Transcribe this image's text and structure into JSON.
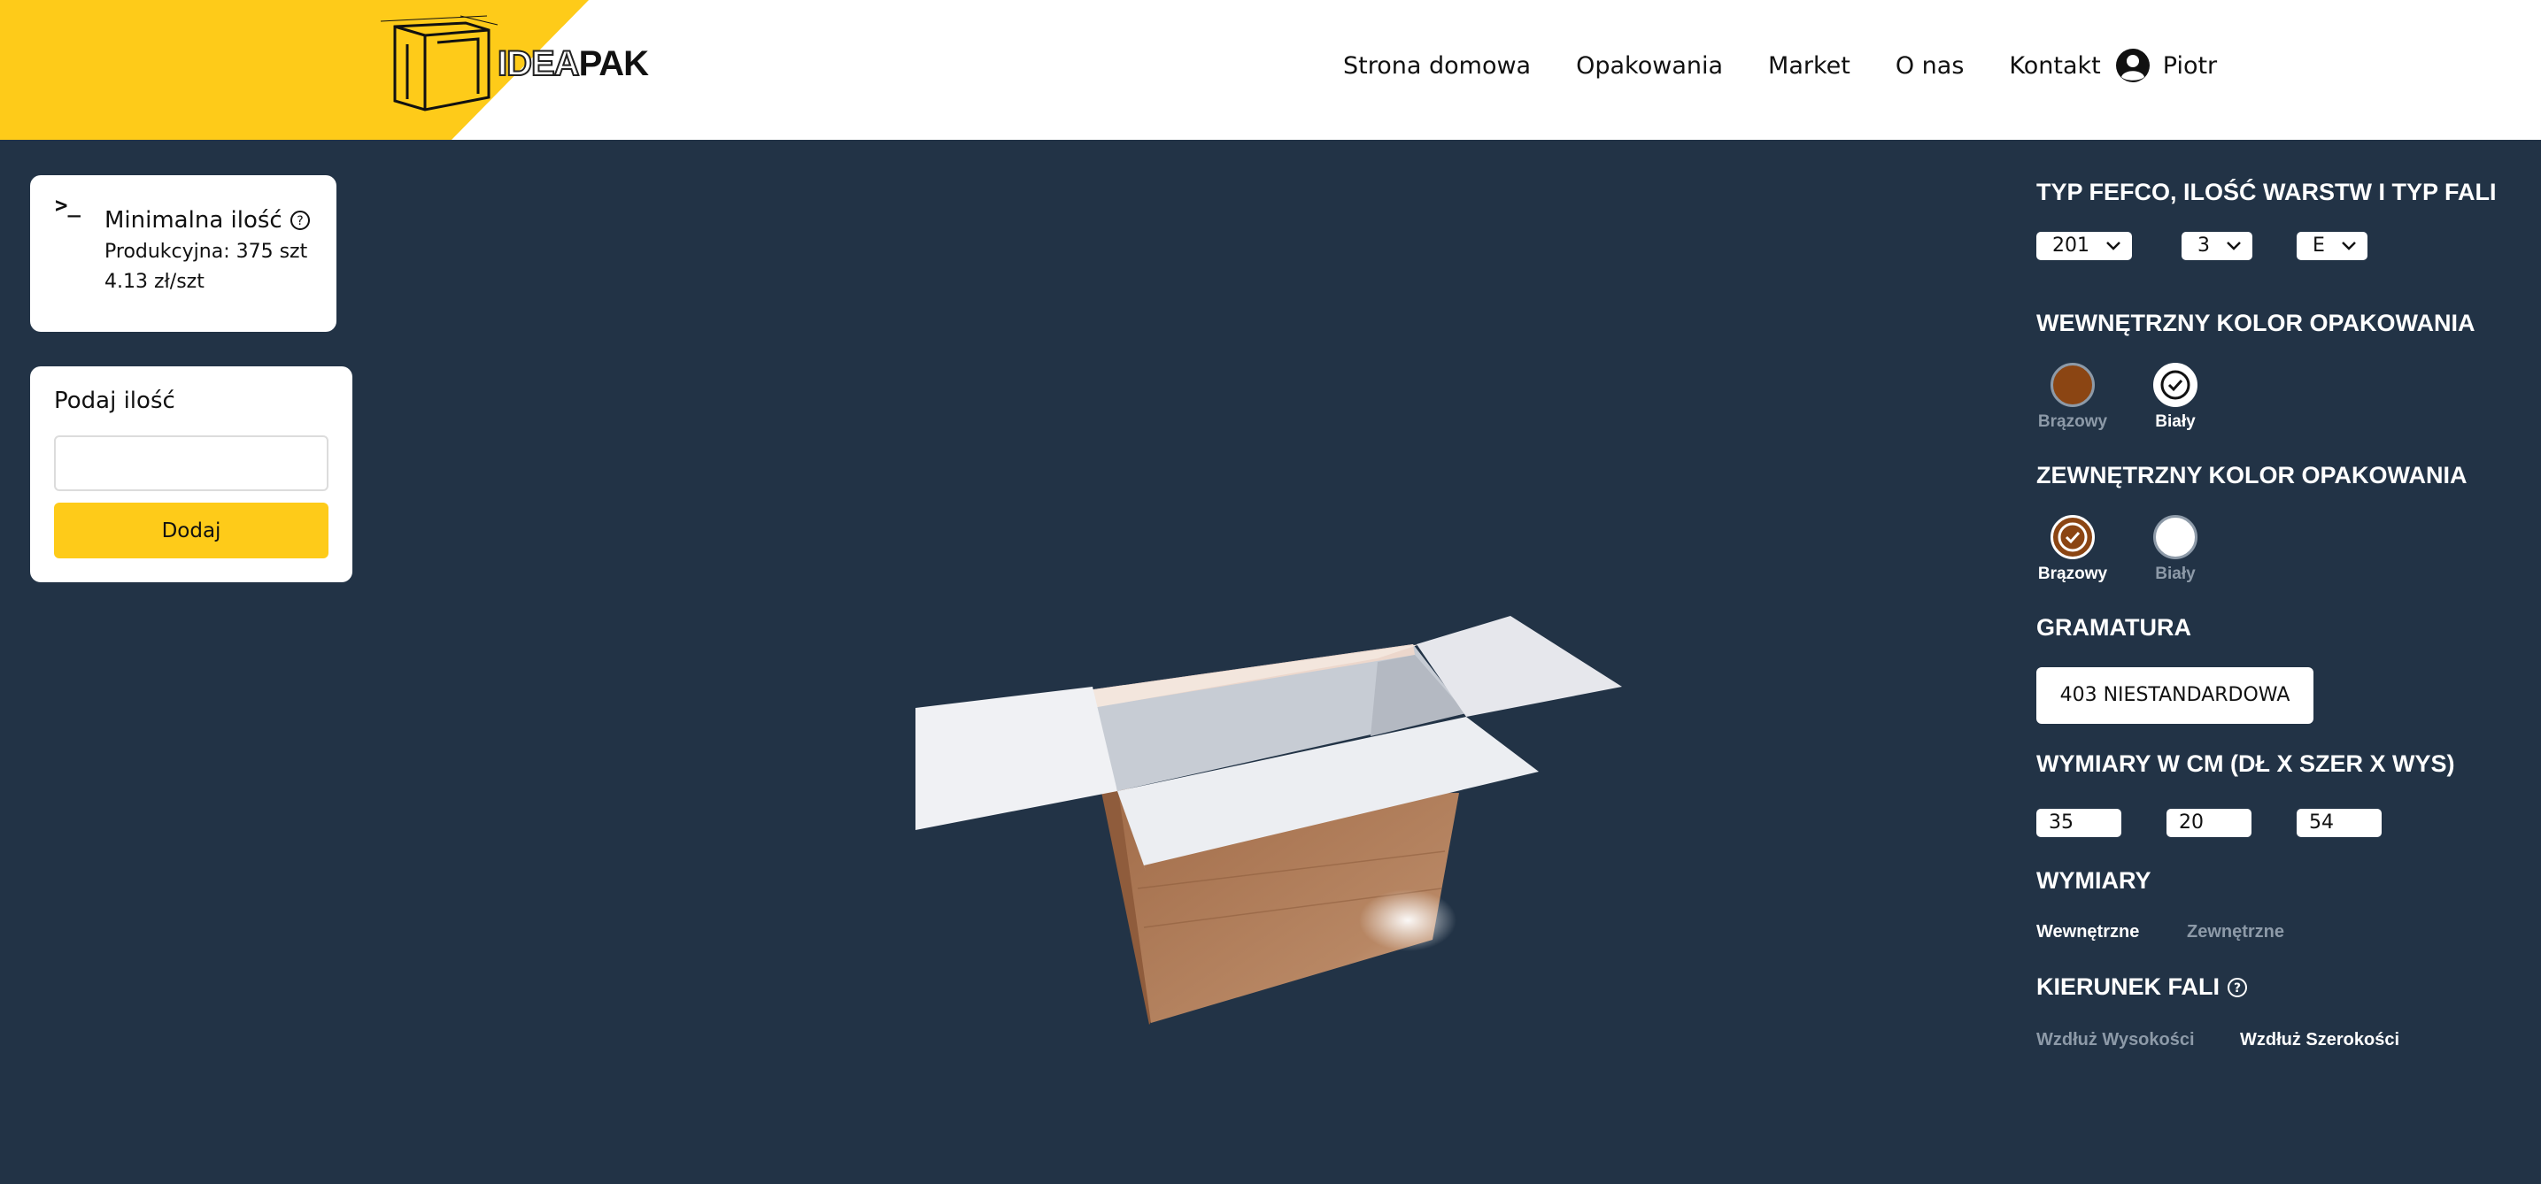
{
  "header": {
    "logo": {
      "part1": "IDEA",
      "part2": "PAK"
    },
    "nav": [
      "Strona domowa",
      "Opakowania",
      "Market",
      "O nas",
      "Kontakt"
    ],
    "user_name": "Piotr"
  },
  "min_card": {
    "icon": "terminal-icon",
    "title": "Minimalna ilość",
    "production": "Produkcyjna: 375 szt",
    "price": "4.13 zł/szt"
  },
  "qty_card": {
    "label": "Podaj ilość",
    "input_value": "",
    "button": "Dodaj"
  },
  "config": {
    "fefco_title": "TYP FEFCO,  ILOŚĆ WARSTW I TYP FALI",
    "fefco": "201",
    "layers": "3",
    "wave": "E",
    "inner_color_title": "WEWNĘTRZNY KOLOR OPAKOWANIA",
    "inner_colors": [
      {
        "label": "Brązowy",
        "color": "#8b4513",
        "selected": false
      },
      {
        "label": "Biały",
        "color": "#ffffff",
        "selected": true
      }
    ],
    "outer_color_title": "ZEWNĘTRZNY KOLOR OPAKOWANIA",
    "outer_colors": [
      {
        "label": "Brązowy",
        "color": "#8b4513",
        "selected": true
      },
      {
        "label": "Biały",
        "color": "#ffffff",
        "selected": false
      }
    ],
    "grammage_title": "GRAMATURA",
    "grammage": "403 NIESTANDARDOWA",
    "dims_title": "WYMIARY W CM (DŁ X SZER X WYS)",
    "dims": [
      "35",
      "20",
      "54"
    ],
    "dim_type_title": "WYMIARY",
    "dim_types": [
      "Wewnętrzne",
      "Zewnętrzne"
    ],
    "wave_dir_title": "KIERUNEK FALI",
    "wave_dirs": [
      "Wzdłuż Wysokości",
      "Wzdłuż Szerokości"
    ]
  },
  "colors": {
    "accent": "#fecb19",
    "background": "#223346"
  }
}
